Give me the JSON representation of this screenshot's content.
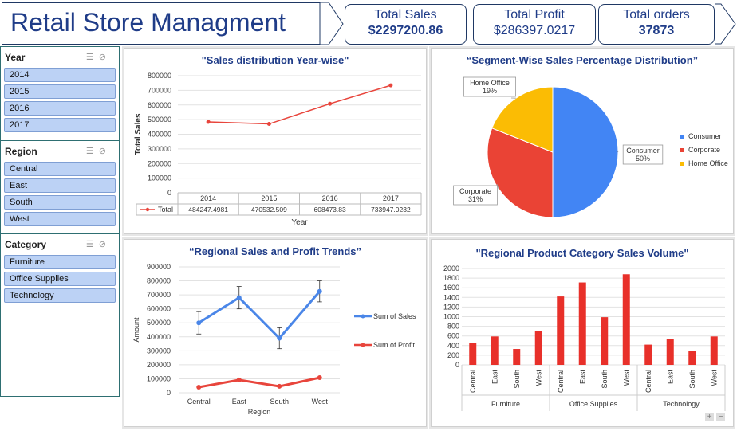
{
  "header": {
    "title": "Retail Store Managment",
    "kpis": [
      {
        "label": "Total Sales",
        "value": "$2297200.86"
      },
      {
        "label": "Total Profit",
        "value": "$286397.0217"
      },
      {
        "label": "Total orders",
        "value": "37873"
      }
    ]
  },
  "slicers": [
    {
      "title": "Year",
      "items": [
        "2014",
        "2015",
        "2016",
        "2017"
      ]
    },
    {
      "title": "Region",
      "items": [
        "Central",
        "East",
        "South",
        "West"
      ]
    },
    {
      "title": "Category",
      "items": [
        "Furniture",
        "Office Supplies",
        "Technology"
      ]
    }
  ],
  "chart_data": [
    {
      "type": "line",
      "title": "\"Sales distribution Year-wise\"",
      "xlabel": "Year",
      "ylabel": "Total Sales",
      "categories": [
        "2014",
        "2015",
        "2016",
        "2017"
      ],
      "series": [
        {
          "name": "Total",
          "values": [
            484247.4981,
            470532.509,
            608473.83,
            733947.0232
          ],
          "labels": [
            "484247.4981",
            "470532.509",
            "608473.83",
            "733947.0232"
          ]
        }
      ],
      "ylim": [
        0,
        800000
      ],
      "yticks": [
        "0",
        "100000",
        "200000",
        "300000",
        "400000",
        "500000",
        "600000",
        "700000",
        "800000"
      ],
      "color": "#e8453c",
      "data_table": true
    },
    {
      "type": "pie",
      "title": "“Segment-Wise Sales Percentage Distribution”",
      "slices": [
        {
          "name": "Consumer",
          "value": 50,
          "label": "Consumer\n50%",
          "color": "#4285f4"
        },
        {
          "name": "Corporate",
          "value": 31,
          "label": "Corporate\n31%",
          "color": "#ea4335"
        },
        {
          "name": "Home Office",
          "value": 19,
          "label": "Home Office\n19%",
          "color": "#fbbc04"
        }
      ],
      "legend": "right"
    },
    {
      "type": "line",
      "title": "“Regional Sales and Profit Trends”",
      "xlabel": "Region",
      "ylabel": "Amount",
      "categories": [
        "Central",
        "East",
        "South",
        "West"
      ],
      "series": [
        {
          "name": "Sum of Sales",
          "values": [
            500000,
            680000,
            390000,
            725000
          ],
          "error": [
            80000,
            80000,
            75000,
            75000
          ],
          "color": "#4a86e8"
        },
        {
          "name": "Sum of Profit",
          "values": [
            40000,
            92000,
            46000,
            108000
          ],
          "color": "#e8453c"
        }
      ],
      "ylim": [
        0,
        900000
      ],
      "yticks": [
        "0",
        "100000",
        "200000",
        "300000",
        "400000",
        "500000",
        "600000",
        "700000",
        "800000",
        "900000"
      ],
      "legend": "right"
    },
    {
      "type": "bar",
      "title": "\"Regional Product Category Sales Volume\"",
      "groups": [
        {
          "name": "Furniture",
          "categories": [
            "Central",
            "East",
            "South",
            "West"
          ],
          "values": [
            460,
            590,
            330,
            700
          ]
        },
        {
          "name": "Office Supplies",
          "categories": [
            "Central",
            "East",
            "South",
            "West"
          ],
          "values": [
            1420,
            1710,
            990,
            1880
          ]
        },
        {
          "name": "Technology",
          "categories": [
            "Central",
            "East",
            "South",
            "West"
          ],
          "values": [
            420,
            540,
            290,
            590
          ]
        }
      ],
      "ylim": [
        0,
        2000
      ],
      "yticks": [
        "0",
        "200",
        "400",
        "600",
        "800",
        "1000",
        "1200",
        "1400",
        "1600",
        "1800",
        "2000"
      ],
      "color": "#e8302a"
    }
  ],
  "zoom_controls": {
    "plus": "+",
    "minus": "−"
  }
}
